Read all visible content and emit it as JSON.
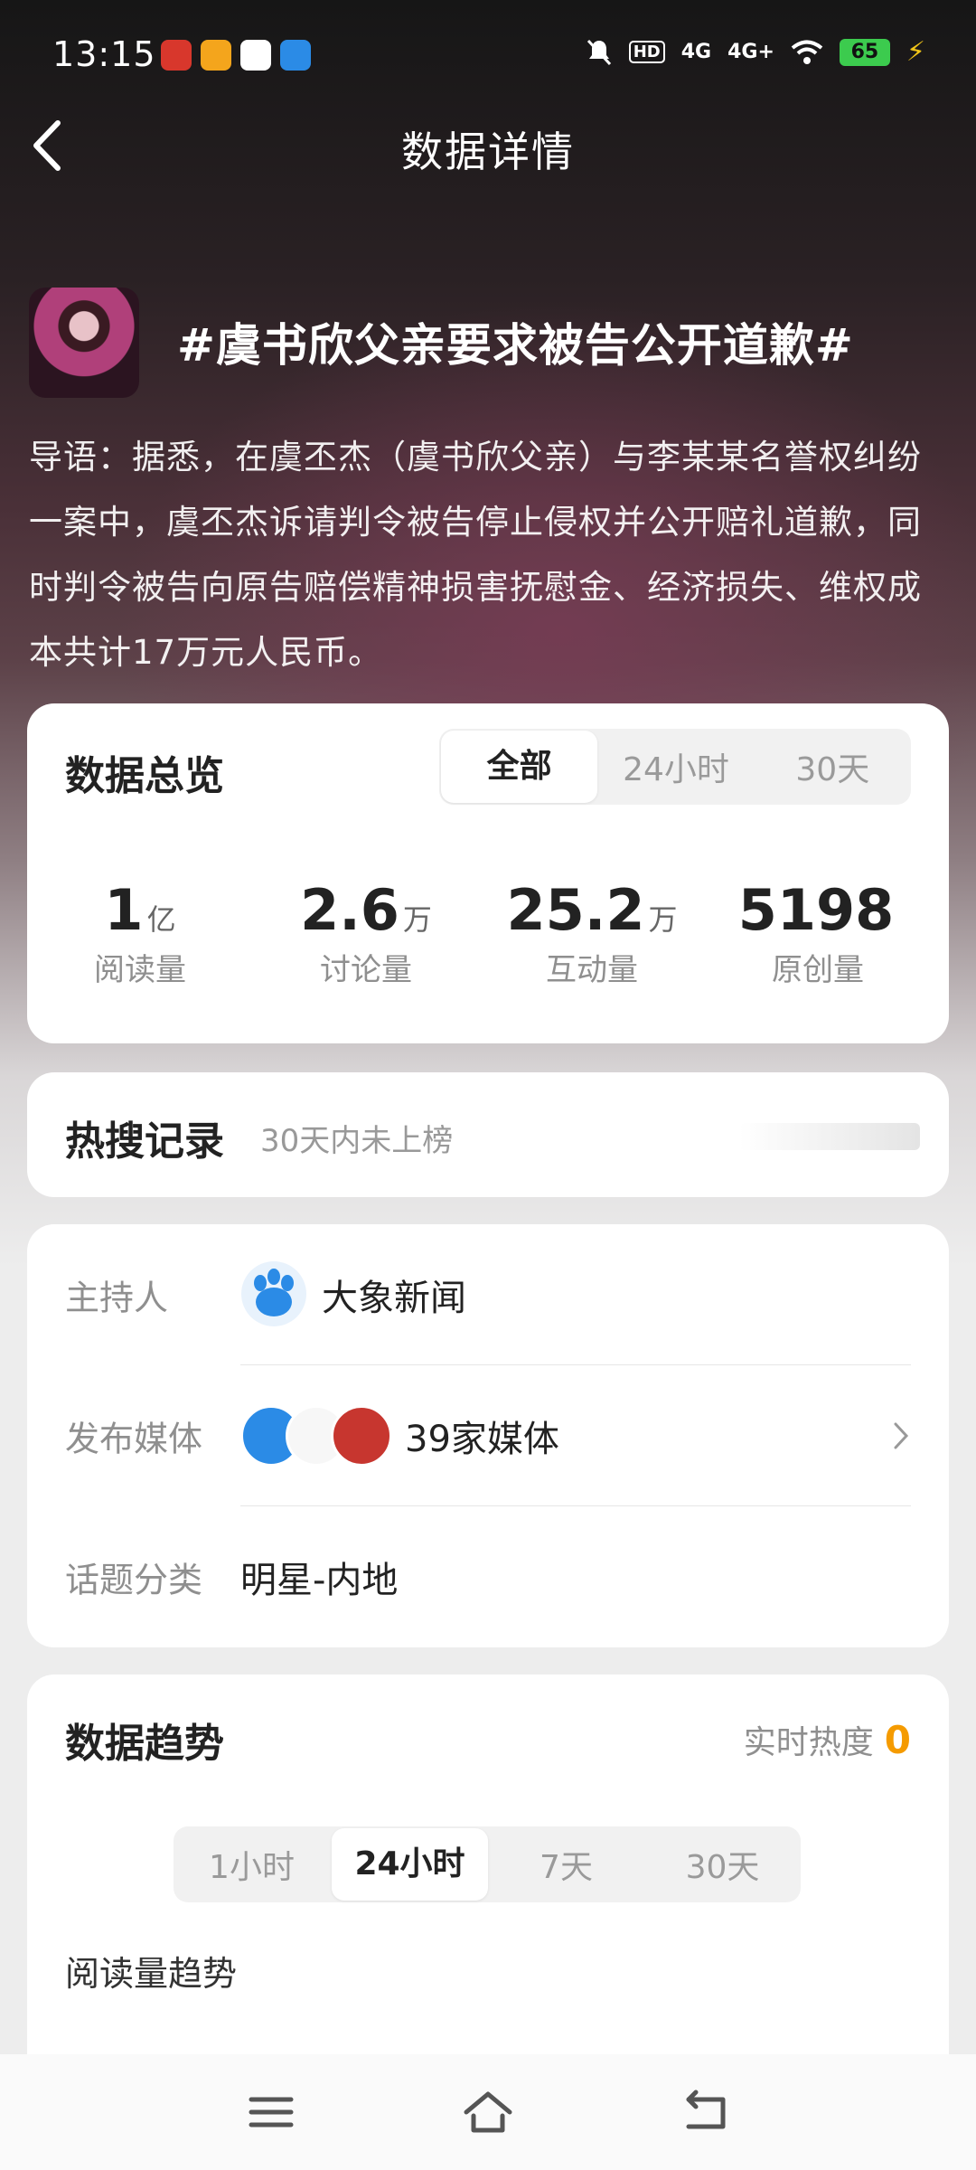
{
  "status": {
    "time": "13:15",
    "battery": "65"
  },
  "header": {
    "title": "数据详情"
  },
  "topic": {
    "title": "#虞书欣父亲要求被告公开道歉#",
    "intro": "导语：据悉，在虞丕杰（虞书欣父亲）与李某某名誉权纠纷一案中，虞丕杰诉请判令被告停止侵权并公开赔礼道歉，同时判令被告向原告赔偿精神损害抚慰金、经济损失、维权成本共计17万元人民币。"
  },
  "overview": {
    "title": "数据总览",
    "tabs": [
      "全部",
      "24小时",
      "30天"
    ],
    "stats": [
      {
        "value": "1",
        "unit": "亿",
        "label": "阅读量"
      },
      {
        "value": "2.6",
        "unit": "万",
        "label": "讨论量"
      },
      {
        "value": "25.2",
        "unit": "万",
        "label": "互动量"
      },
      {
        "value": "5198",
        "unit": "",
        "label": "原创量"
      }
    ]
  },
  "hot_search": {
    "title": "热搜记录",
    "subtitle": "30天内未上榜"
  },
  "info": {
    "host_label": "主持人",
    "host_value": "大象新闻",
    "media_label": "发布媒体",
    "media_value": "39家媒体",
    "category_label": "话题分类",
    "category_value": "明星-内地"
  },
  "trend": {
    "title": "数据趋势",
    "realtime_label": "实时热度",
    "realtime_value": "0",
    "tabs": [
      "1小时",
      "24小时",
      "7天",
      "30天"
    ],
    "subtitle": "阅读量趋势"
  },
  "colors": {
    "accent_orange": "#f59b00",
    "battery_green": "#3ccb4e",
    "baidu_blue": "#2b8be6"
  }
}
